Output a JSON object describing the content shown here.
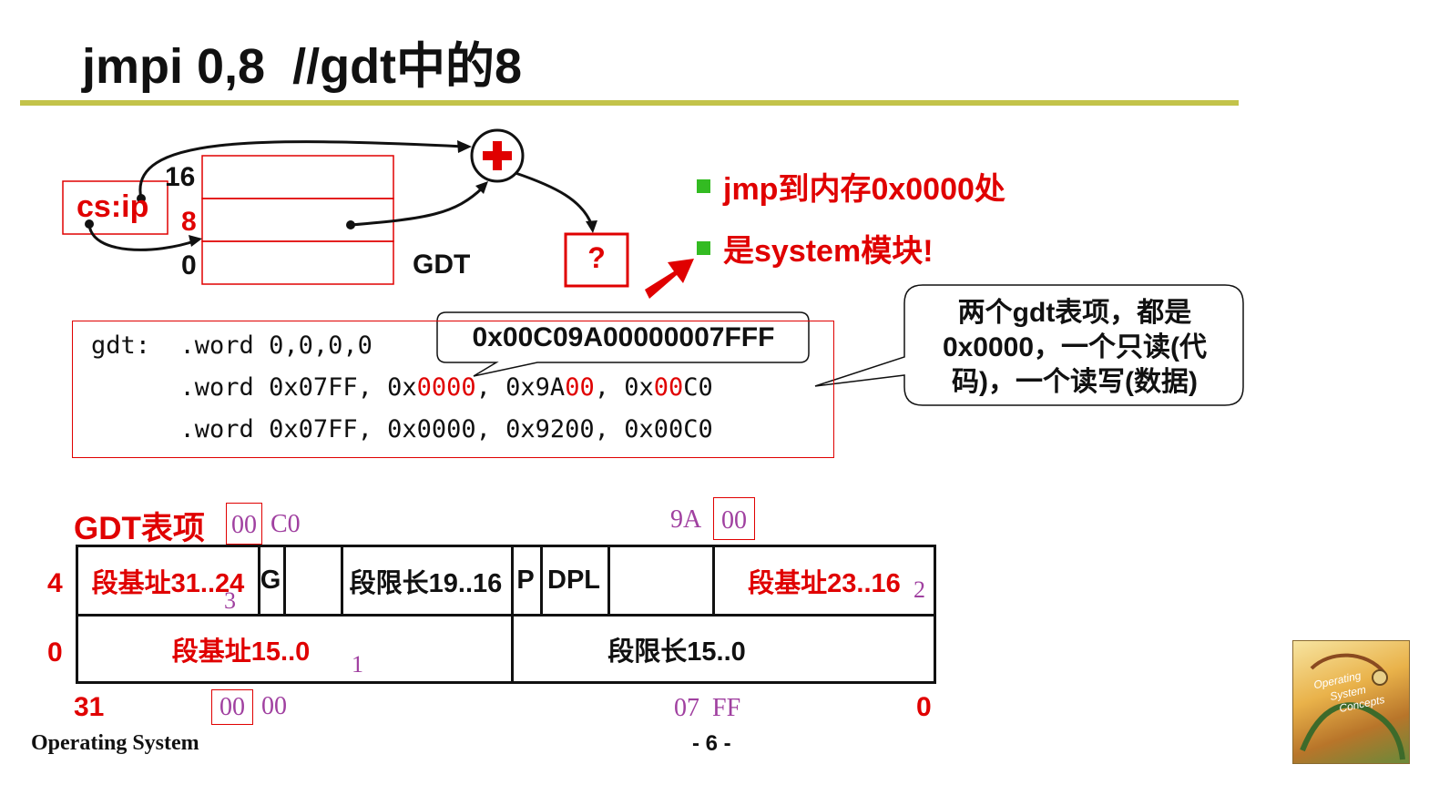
{
  "slide": {
    "title": "jmpi 0,8  //gdt中的8",
    "footer_left": "Operating System",
    "page_number": "- 6 -",
    "accent_color": "#c3c34a",
    "highlight_color": "#e00000"
  },
  "diagram": {
    "cs_ip_label": "cs:ip",
    "index_16": "16",
    "index_8": "8",
    "index_0": "0",
    "gdt_label": "GDT",
    "question_mark": "?"
  },
  "bullets": [
    "jmp到内存0x0000处",
    "是system模块!"
  ],
  "code": {
    "line1": "gdt:  .word 0,0,0,0",
    "line2_prefix": "      .word 0x07FF, 0x",
    "line2_red1": "0000",
    "line2_mid": ", 0x9A",
    "line2_red2": "00",
    "line2_mid2": ", 0x",
    "line2_red3": "00",
    "line2_suffix": "C0",
    "line3": "      .word 0x07FF, 0x0000, 0x9200, 0x00C0"
  },
  "callout_hex": "0x00C09A00000007FFF",
  "note": {
    "line1": "两个gdt表项，都是",
    "line2": "0x0000，一个只读(代",
    "line3": "码)，一个读写(数据)"
  },
  "gdt_entry": {
    "heading": "GDT表项",
    "top_left_boxed": "00",
    "top_left_plain": "C0",
    "top_right_plain": "9A",
    "top_right_boxed": "00",
    "row_label_4": "4",
    "row_label_0": "0",
    "row4": {
      "base_31_24": "段基址31..24",
      "g": "G",
      "limit_19_16": "段限长19..16",
      "p": "P",
      "dpl": "DPL",
      "base_23_16": "段基址23..16"
    },
    "row0": {
      "base_15_0": "段基址15..0",
      "limit_15_0": "段限长15..0"
    },
    "marker_3": "3",
    "marker_2": "2",
    "marker_1": "1",
    "bottom_left": "31",
    "bottom_right": "0",
    "bottom_boxed": "00",
    "bottom_plain1": "00",
    "bottom_plain2": "07  FF"
  },
  "book_cover": {
    "title_line1": "Operating",
    "title_line2": "System",
    "title_line3": "Concepts"
  }
}
